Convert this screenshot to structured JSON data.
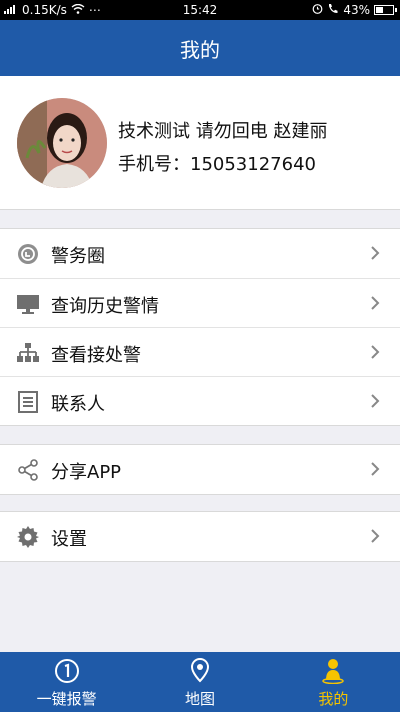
{
  "status_bar": {
    "network_speed": "0.15K/s",
    "time": "15:42",
    "battery": "43%",
    "battery_level": 0.43
  },
  "header": {
    "title": "我的"
  },
  "profile": {
    "name": "技术测试 请勿回电 赵建丽",
    "phone": "手机号：15053127640"
  },
  "menu": {
    "group1": [
      {
        "label": "警务圈",
        "icon": "circle-chat-icon"
      },
      {
        "label": "查询历史警情",
        "icon": "monitor-icon"
      },
      {
        "label": "查看接处警",
        "icon": "org-tree-icon"
      },
      {
        "label": "联系人",
        "icon": "contacts-icon"
      }
    ],
    "group2": [
      {
        "label": "分享APP",
        "icon": "share-icon"
      }
    ],
    "group3": [
      {
        "label": "设置",
        "icon": "gear-icon"
      }
    ]
  },
  "tabbar": [
    {
      "label": "一键报警",
      "icon": "alarm-icon"
    },
    {
      "label": "地图",
      "icon": "map-pin-icon"
    },
    {
      "label": "我的",
      "icon": "person-icon",
      "active": true
    }
  ],
  "colors": {
    "brand_blue": "#1f5aa8",
    "active_tab": "#f5c400",
    "background": "#efeff4"
  }
}
